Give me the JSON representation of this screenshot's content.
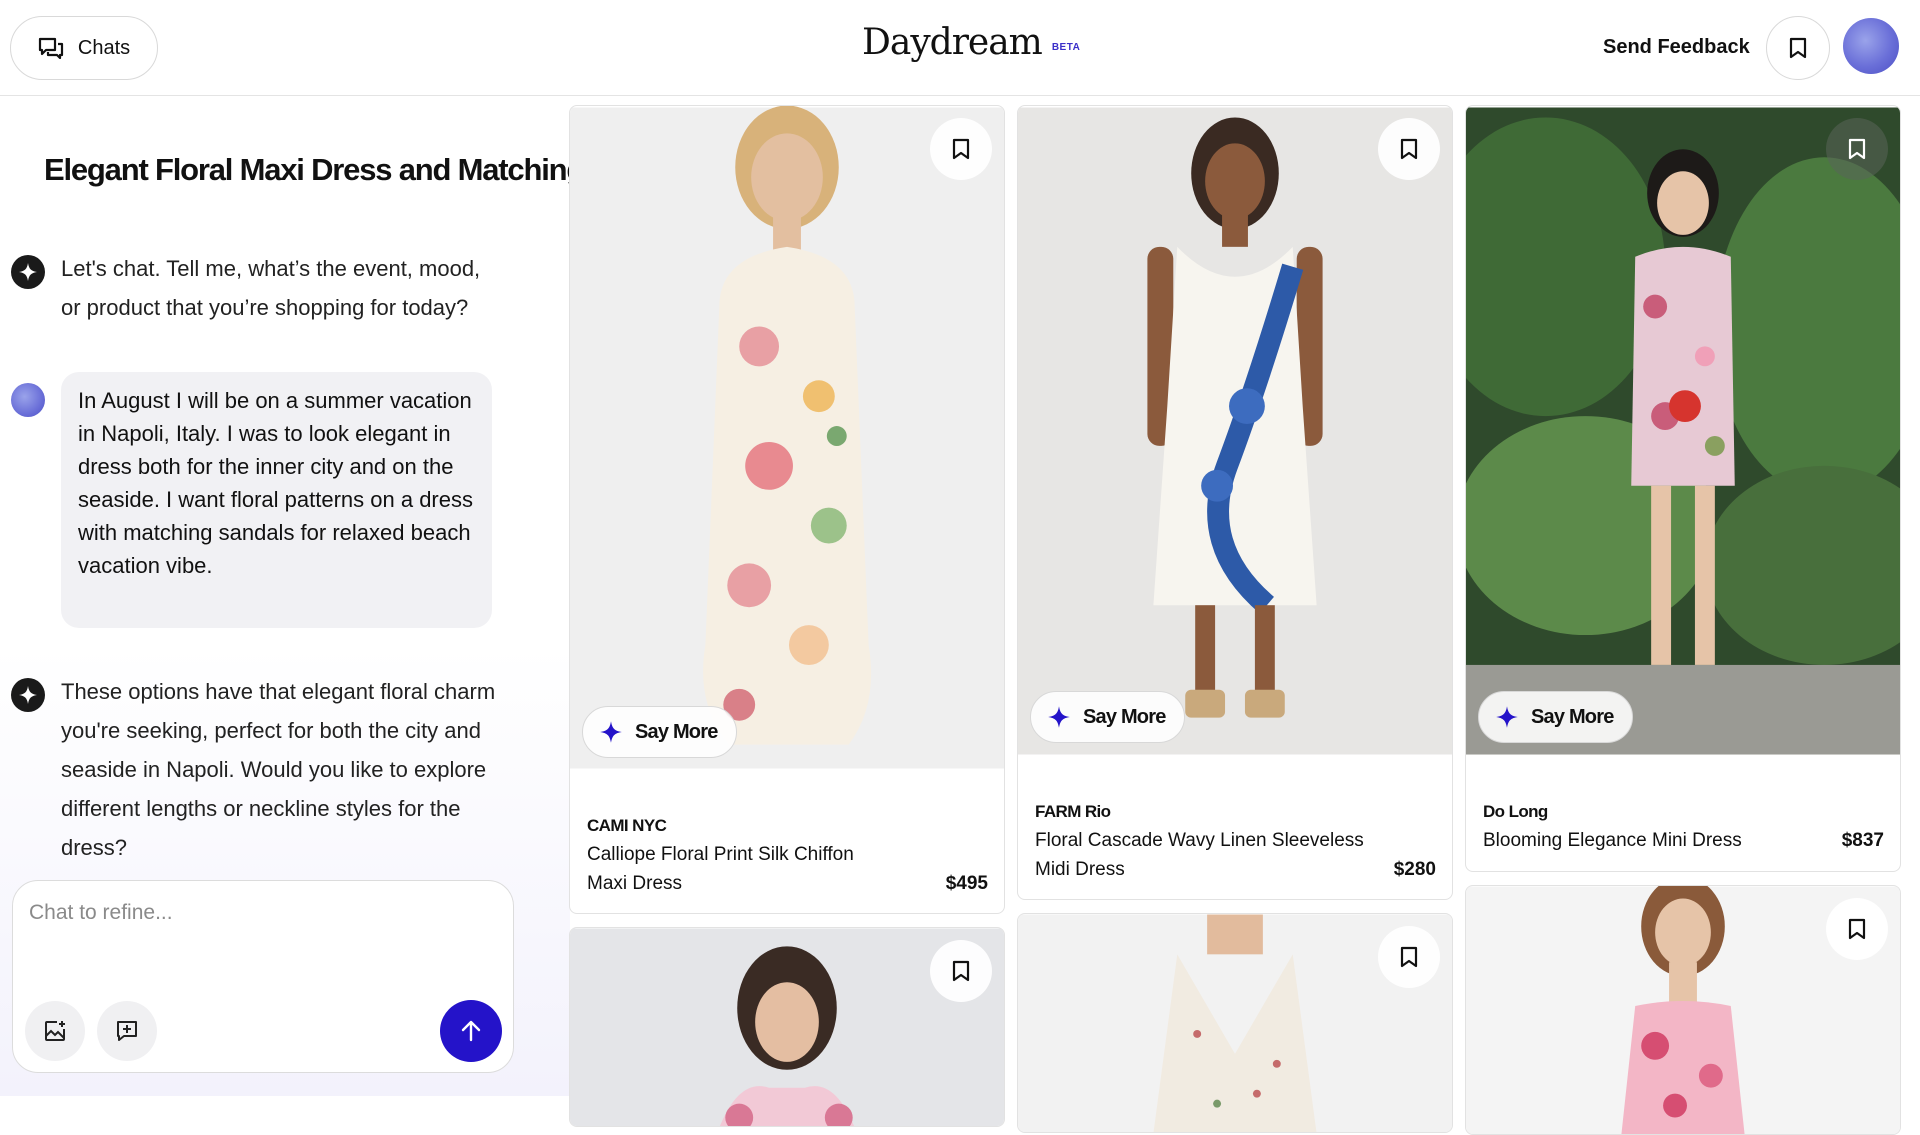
{
  "header": {
    "chats_label": "Chats",
    "logo": "Daydream",
    "beta": "BETA",
    "feedback": "Send Feedback"
  },
  "conversation": {
    "title": "Elegant Floral Maxi Dress and Matching...",
    "messages": [
      {
        "role": "assistant",
        "text": "Let's chat. Tell me, what’s the event, mood, or product that you’re shopping for today?"
      },
      {
        "role": "user",
        "text": "In August I will be on a summer vacation in Napoli, Italy. I was to look elegant in dress both for the inner city and on the seaside. I want floral patterns on a dress with matching sandals for relaxed beach vacation vibe."
      },
      {
        "role": "assistant",
        "text": "These options have that elegant floral charm you're seeking, perfect for both the city and seaside in Napoli. Would you like to explore different lengths or neckline styles for the dress?"
      }
    ],
    "input_placeholder": "Chat to refine..."
  },
  "products": [
    {
      "brand": "CAMI NYC",
      "name": "Calliope Floral Print Silk Chiffon Maxi Dress",
      "price": "$495",
      "action": "Say More"
    },
    {
      "brand": "FARM Rio",
      "name": "Floral Cascade Wavy Linen Sleeveless Midi Dress",
      "price": "$280",
      "action": "Say More"
    },
    {
      "brand": "Do Long",
      "name": "Blooming Elegance Mini Dress",
      "price": "$837",
      "action": "Say More"
    }
  ],
  "colors": {
    "accent": "#2413c9",
    "bubble": "#f1f1f4"
  }
}
